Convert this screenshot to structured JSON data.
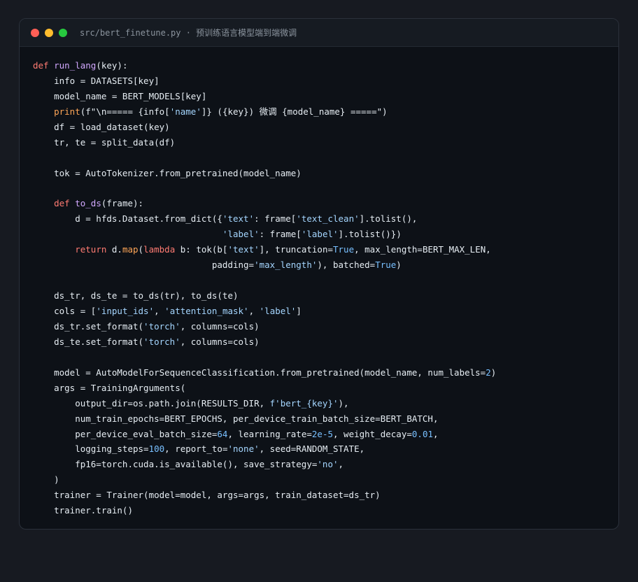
{
  "window": {
    "title": "src/bert_finetune.py · 预训练语言模型端到端微调"
  },
  "colors": {
    "background": "#171a21",
    "editor": "#0d1117",
    "titlebar": "#161b22",
    "keyword": "#ff7b72",
    "function": "#d2a8ff",
    "string": "#a5d6ff",
    "number": "#79c0ff",
    "text": "#e6edf3"
  },
  "code": {
    "lines": [
      [
        {
          "t": "def",
          "c": "kw"
        },
        {
          "t": " "
        },
        {
          "t": "run_lang",
          "c": "fn"
        },
        {
          "t": "(key):"
        }
      ],
      [
        {
          "t": "    info = DATASETS[key]"
        }
      ],
      [
        {
          "t": "    model_name = BERT_MODELS[key]"
        }
      ],
      [
        {
          "t": "    "
        },
        {
          "t": "print",
          "c": "bi"
        },
        {
          "t": "(f\"\\n===== {info["
        },
        {
          "t": "'name'",
          "c": "str"
        },
        {
          "t": "]} ({key}) 微调 {model_name} =====\")"
        }
      ],
      [
        {
          "t": "    df = load_dataset(key)"
        }
      ],
      [
        {
          "t": "    tr, te = split_data(df)"
        }
      ],
      [],
      [
        {
          "t": "    tok = AutoTokenizer.from_pretrained(model_name)"
        }
      ],
      [],
      [
        {
          "t": "    "
        },
        {
          "t": "def",
          "c": "kw"
        },
        {
          "t": " "
        },
        {
          "t": "to_ds",
          "c": "fn"
        },
        {
          "t": "(frame):"
        }
      ],
      [
        {
          "t": "        d = hfds.Dataset.from_dict({"
        },
        {
          "t": "'text'",
          "c": "str"
        },
        {
          "t": ": frame["
        },
        {
          "t": "'text_clean'",
          "c": "str"
        },
        {
          "t": "].tolist(),"
        }
      ],
      [
        {
          "t": "                                    "
        },
        {
          "t": "'label'",
          "c": "str"
        },
        {
          "t": ": frame["
        },
        {
          "t": "'label'",
          "c": "str"
        },
        {
          "t": "].tolist()})"
        }
      ],
      [
        {
          "t": "        "
        },
        {
          "t": "return",
          "c": "kw"
        },
        {
          "t": " d."
        },
        {
          "t": "map",
          "c": "bi"
        },
        {
          "t": "("
        },
        {
          "t": "lambda",
          "c": "kw"
        },
        {
          "t": " b: tok(b["
        },
        {
          "t": "'text'",
          "c": "str"
        },
        {
          "t": "], truncation="
        },
        {
          "t": "True",
          "c": "num"
        },
        {
          "t": ", max_length=BERT_MAX_LEN,"
        }
      ],
      [
        {
          "t": "                                  padding="
        },
        {
          "t": "'max_length'",
          "c": "str"
        },
        {
          "t": "), batched="
        },
        {
          "t": "True",
          "c": "num"
        },
        {
          "t": ")"
        }
      ],
      [],
      [
        {
          "t": "    ds_tr, ds_te = to_ds(tr), to_ds(te)"
        }
      ],
      [
        {
          "t": "    cols = ["
        },
        {
          "t": "'input_ids'",
          "c": "str"
        },
        {
          "t": ", "
        },
        {
          "t": "'attention_mask'",
          "c": "str"
        },
        {
          "t": ", "
        },
        {
          "t": "'label'",
          "c": "str"
        },
        {
          "t": "]"
        }
      ],
      [
        {
          "t": "    ds_tr.set_format("
        },
        {
          "t": "'torch'",
          "c": "str"
        },
        {
          "t": ", columns=cols)"
        }
      ],
      [
        {
          "t": "    ds_te.set_format("
        },
        {
          "t": "'torch'",
          "c": "str"
        },
        {
          "t": ", columns=cols)"
        }
      ],
      [],
      [
        {
          "t": "    model = AutoModelForSequenceClassification.from_pretrained(model_name, num_labels="
        },
        {
          "t": "2",
          "c": "num"
        },
        {
          "t": ")"
        }
      ],
      [
        {
          "t": "    args = TrainingArguments("
        }
      ],
      [
        {
          "t": "        output_dir=os.path.join(RESULTS_DIR, "
        },
        {
          "t": "f'bert_{key}'",
          "c": "str"
        },
        {
          "t": "),"
        }
      ],
      [
        {
          "t": "        num_train_epochs=BERT_EPOCHS, per_device_train_batch_size=BERT_BATCH,"
        }
      ],
      [
        {
          "t": "        per_device_eval_batch_size="
        },
        {
          "t": "64",
          "c": "num"
        },
        {
          "t": ", learning_rate="
        },
        {
          "t": "2e-5",
          "c": "num"
        },
        {
          "t": ", weight_decay="
        },
        {
          "t": "0.01",
          "c": "num"
        },
        {
          "t": ","
        }
      ],
      [
        {
          "t": "        logging_steps="
        },
        {
          "t": "100",
          "c": "num"
        },
        {
          "t": ", report_to="
        },
        {
          "t": "'none'",
          "c": "str"
        },
        {
          "t": ", seed=RANDOM_STATE,"
        }
      ],
      [
        {
          "t": "        fp16=torch.cuda.is_available(), save_strategy="
        },
        {
          "t": "'no'",
          "c": "str"
        },
        {
          "t": ","
        }
      ],
      [
        {
          "t": "    )"
        }
      ],
      [
        {
          "t": "    trainer = Trainer(model=model, args=args, train_dataset=ds_tr)"
        }
      ],
      [
        {
          "t": "    trainer.train()"
        }
      ]
    ]
  }
}
